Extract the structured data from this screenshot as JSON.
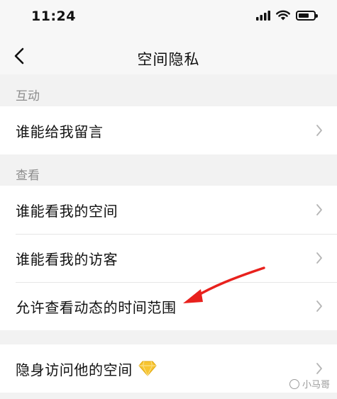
{
  "status_bar": {
    "time": "11:24",
    "icons": [
      "signal-icon",
      "wifi-icon",
      "battery-icon"
    ]
  },
  "nav": {
    "title": "空间隐私",
    "back_icon": "chevron-left-icon"
  },
  "sections": [
    {
      "label": "互动",
      "items": [
        {
          "label": "谁能给我留言"
        }
      ]
    },
    {
      "label": "查看",
      "items": [
        {
          "label": "谁能看我的空间"
        },
        {
          "label": "谁能看我的访客"
        },
        {
          "label": "允许查看动态的时间范围"
        }
      ]
    },
    {
      "label": "",
      "items": [
        {
          "label": "隐身访问他的空间",
          "badge_icon": "diamond-icon"
        }
      ]
    }
  ],
  "watermark": "小马哥"
}
